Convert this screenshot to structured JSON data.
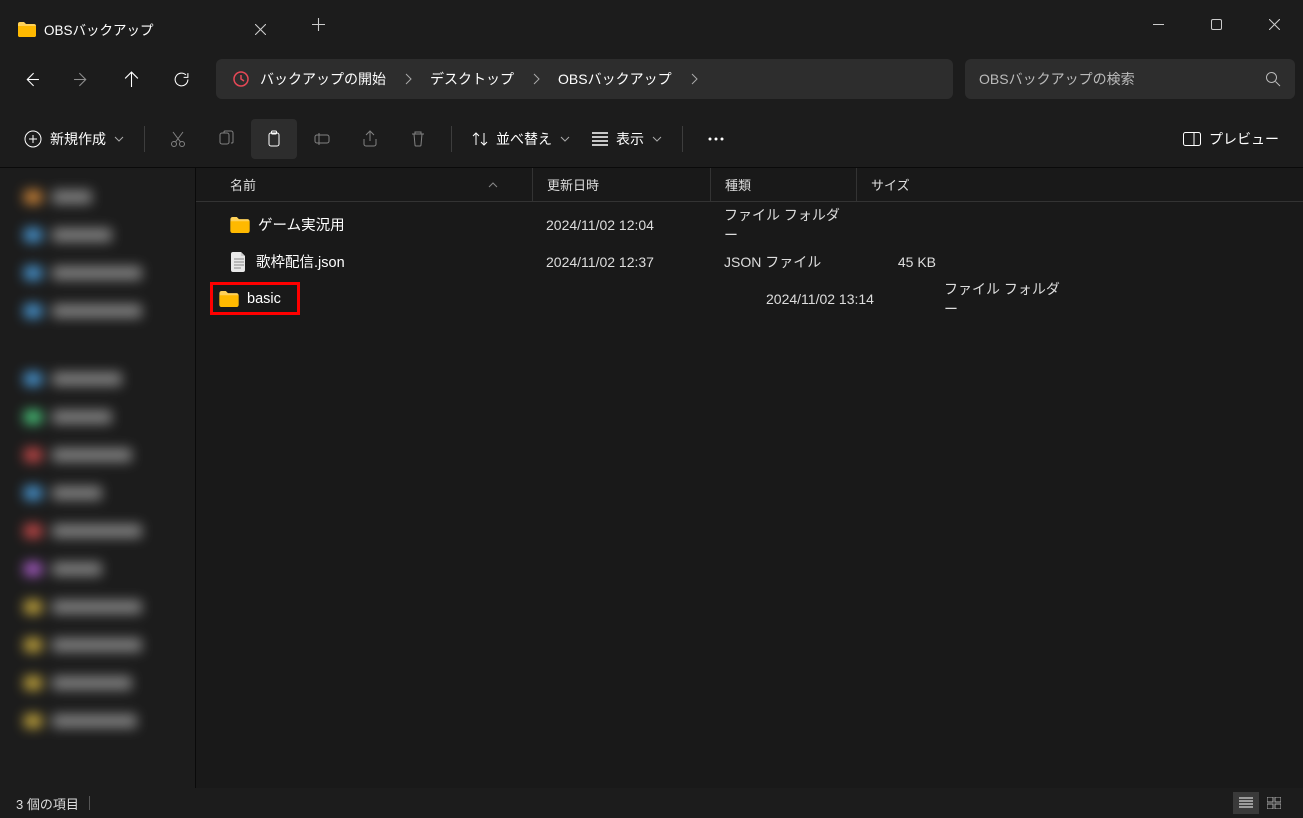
{
  "titlebar": {
    "tab_title": "OBSバックアップ"
  },
  "breadcrumb": {
    "items": [
      "バックアップの開始",
      "デスクトップ",
      "OBSバックアップ"
    ]
  },
  "search": {
    "placeholder": "OBSバックアップの検索"
  },
  "toolbar": {
    "new_label": "新規作成",
    "sort_label": "並べ替え",
    "view_label": "表示",
    "preview_label": "プレビュー"
  },
  "columns": {
    "name": "名前",
    "date": "更新日時",
    "type": "種類",
    "size": "サイズ"
  },
  "files": [
    {
      "name": "ゲーム実況用",
      "date": "2024/11/02 12:04",
      "type": "ファイル フォルダー",
      "size": "",
      "icon": "folder"
    },
    {
      "name": "歌枠配信.json",
      "date": "2024/11/02 12:37",
      "type": "JSON ファイル",
      "size": "45 KB",
      "icon": "file"
    },
    {
      "name": "basic",
      "date": "2024/11/02 13:14",
      "type": "ファイル フォルダー",
      "size": "",
      "icon": "folder",
      "highlighted": true
    }
  ],
  "statusbar": {
    "count": "3 個の項目"
  }
}
